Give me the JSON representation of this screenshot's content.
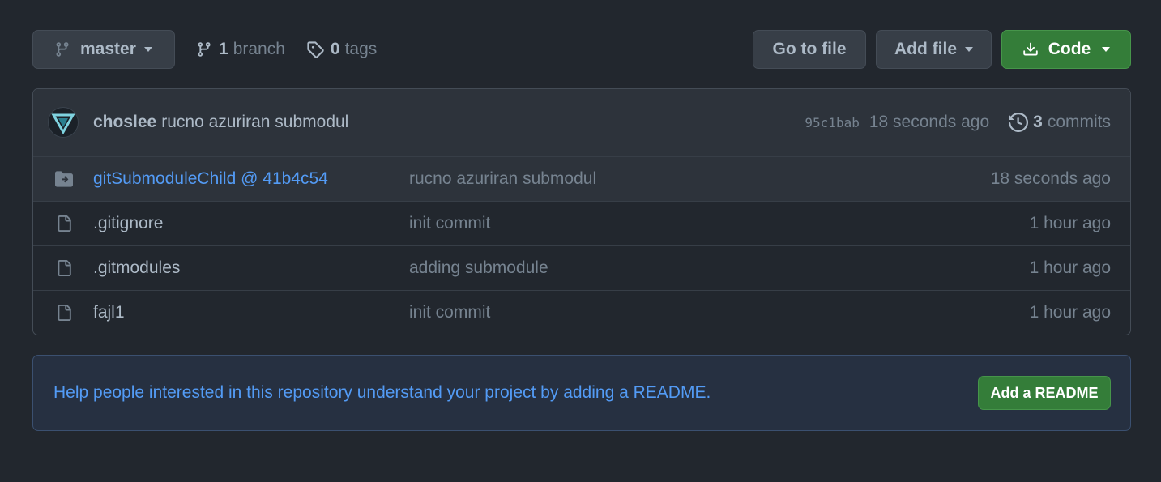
{
  "toolbar": {
    "branch_label": "master",
    "branch_count": "1",
    "branch_word": "branch",
    "tag_count": "0",
    "tag_word": "tags",
    "go_to_file": "Go to file",
    "add_file": "Add file",
    "code": "Code"
  },
  "commit": {
    "author": "choslee",
    "message": "rucno azuriran submodul",
    "sha": "95c1bab",
    "time": "18 seconds ago",
    "commit_count": "3",
    "commit_word": "commits"
  },
  "files": [
    {
      "name": "gitSubmoduleChild @ 41b4c54",
      "message": "rucno azuriran submodul",
      "age": "18 seconds ago",
      "icon": "submodule-icon"
    },
    {
      "name": ".gitignore",
      "message": "init commit",
      "age": "1 hour ago",
      "icon": "file-icon"
    },
    {
      "name": ".gitmodules",
      "message": "adding submodule",
      "age": "1 hour ago",
      "icon": "file-icon"
    },
    {
      "name": "fajl1",
      "message": "init commit",
      "age": "1 hour ago",
      "icon": "file-icon"
    }
  ],
  "readme": {
    "text": "Help people interested in this repository understand your project by adding a README.",
    "button": "Add a README"
  },
  "colors": {
    "background": "#22272e",
    "accent_green": "#347d39",
    "link_blue": "#539bf5"
  }
}
